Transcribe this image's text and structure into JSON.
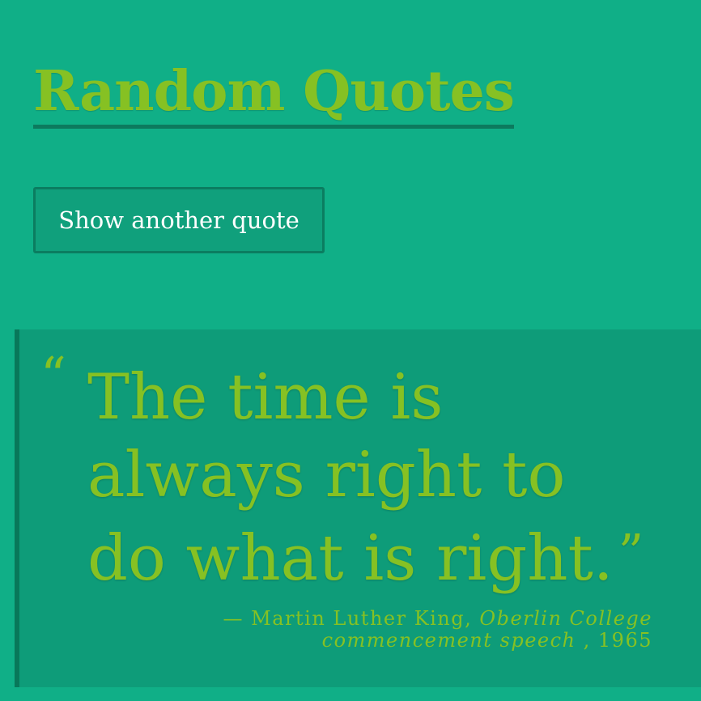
{
  "header": {
    "title": "Random Quotes"
  },
  "controls": {
    "next_button_label": "Show another quote"
  },
  "quote": {
    "open_mark": "“",
    "text": "The time is always right to do what is right.",
    "close_mark": "”",
    "dash": "— ",
    "author": "Martin Luther King,",
    "source": "Oberlin College commencement speech",
    "year": ", 1965"
  },
  "colors": {
    "background": "#10af87",
    "accent_text": "#86c123",
    "quote_panel": "#0e9c79",
    "border_dark": "#0b7d60"
  }
}
